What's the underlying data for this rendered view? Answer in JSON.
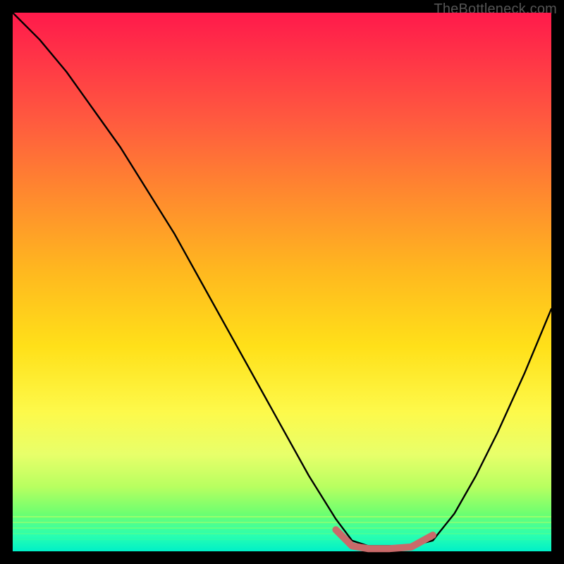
{
  "watermark": "TheBottleneck.com",
  "chart_data": {
    "type": "line",
    "title": "",
    "xlabel": "",
    "ylabel": "",
    "xlim": [
      0,
      100
    ],
    "ylim": [
      0,
      100
    ],
    "series": [
      {
        "name": "bottleneck-curve",
        "x": [
          0,
          5,
          10,
          15,
          20,
          25,
          30,
          35,
          40,
          45,
          50,
          55,
          60,
          63,
          66,
          70,
          74,
          78,
          82,
          86,
          90,
          95,
          100
        ],
        "values": [
          100,
          95,
          89,
          82,
          75,
          67,
          59,
          50,
          41,
          32,
          23,
          14,
          6,
          2,
          1,
          1,
          1,
          2,
          7,
          14,
          22,
          33,
          45
        ]
      },
      {
        "name": "optimal-range-marker",
        "x": [
          60,
          63,
          66,
          70,
          74,
          78
        ],
        "values": [
          4,
          1,
          0.5,
          0.5,
          0.8,
          3
        ]
      }
    ],
    "colors": {
      "curve": "#000000",
      "marker": "#c96a6a",
      "gradient_top": "#ff1a4b",
      "gradient_bottom": "#00f0c8"
    }
  }
}
